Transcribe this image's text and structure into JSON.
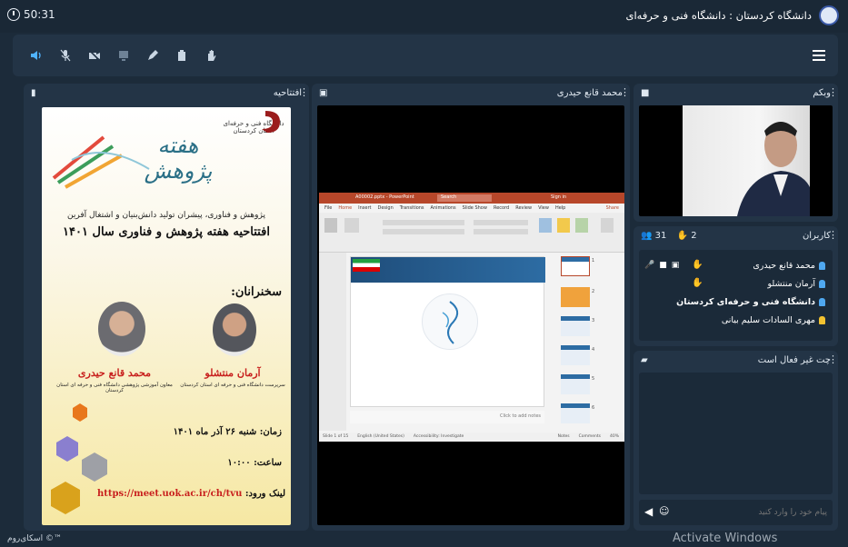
{
  "header": {
    "timer": "50:31",
    "room_title": "دانشگاه کردستان : دانشگاه فنی و حرفه‌ای"
  },
  "toolbar": {
    "buttons": [
      "speaker-icon",
      "mic-icon",
      "camera-off-icon",
      "screen-share-icon",
      "pen-icon",
      "clipboard-icon",
      "raise-hand-icon"
    ]
  },
  "panels": {
    "presentation": {
      "title": "افتتاحیه",
      "slide": {
        "banner": "هفته پژوهش",
        "org_line1": "دانشگاه فنی و حرفه‌ای",
        "org_line2": "استان کردستان",
        "subtitle": "پژوهش و فناوری، پیشران تولید دانش‌بنیان و اشتغال آفرین",
        "heading": "افتتاحیه هفته پژوهش و فناوری سال ۱۴۰۱",
        "speakers_label": "سخنرانان:",
        "speaker1_name": "آرمان منتشلو",
        "speaker1_role": "سرپرست دانشگاه فنی و حرفه ای استان کردستان",
        "speaker2_name": "محمد قانع حیدری",
        "speaker2_role": "معاون آموزشی پژوهشی دانشگاه فنی و حرفه ای استان کردستان",
        "date_label": "زمان:",
        "date_value": "شنبه ۲۶ آذر ماه ۱۴۰۱",
        "time_label": "ساعت:",
        "time_value": "۱۰:۰۰",
        "link_label": "لینک ورود:",
        "link_value": "https://meet.uok.ac.ir/ch/tvu"
      }
    },
    "screen_share": {
      "title": "محمد قانع حیدری",
      "ppt": {
        "window_title": "A00002.pptx - PowerPoint",
        "search": "Search",
        "sign_in": "Sign in",
        "share": "Share",
        "ribbon_tabs": [
          "File",
          "Home",
          "Insert",
          "Design",
          "Transitions",
          "Animations",
          "Slide Show",
          "Record",
          "Review",
          "View",
          "Help"
        ],
        "notes_hint": "Click to add notes",
        "status_left": "Slide 1 of 15",
        "status_lang": "English (United States)",
        "status_access": "Accessibility: Investigate",
        "status_notes": "Notes",
        "status_comments": "Comments",
        "zoom": "40%",
        "thumb_numbers": [
          "1",
          "2",
          "3",
          "4",
          "5",
          "6"
        ]
      }
    },
    "webcam": {
      "title": "وبکم"
    },
    "users": {
      "title": "کاربران",
      "count": "31",
      "hands": "2",
      "list": [
        {
          "name": "محمد قانع حیدری",
          "color": "#4fa8f0"
        },
        {
          "name": "آرمان منتشلو",
          "color": "#4fa8f0"
        },
        {
          "name": "دانشگاه فنی و حرفه‌ای کردستان",
          "color": "#4fa8f0"
        },
        {
          "name": "مهری السادات سلیم بیانی",
          "color": "#f2c230"
        }
      ]
    },
    "chat": {
      "title": "چت غیر فعال است",
      "placeholder": "پیام خود را وارد کنید"
    }
  },
  "footer": {
    "brand": "اسکای‌روم ©™",
    "watermark": "Activate Windows"
  },
  "colors": {
    "bg": "#1c2b3a",
    "panel": "#233446",
    "accent": "#4fb3ff",
    "title_red": "#c8201e"
  }
}
